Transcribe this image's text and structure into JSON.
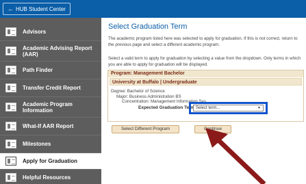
{
  "topbar": {
    "back_label": "HUB Student Center",
    "color": "#0b5ea8"
  },
  "sidebar": {
    "items": [
      {
        "label": "Advisors",
        "active": false
      },
      {
        "label": "Academic Advising Report (AAR)",
        "active": false
      },
      {
        "label": "Path Finder",
        "active": false
      },
      {
        "label": "Transfer Credit Report",
        "active": false
      },
      {
        "label": "Academic Program Information",
        "active": false
      },
      {
        "label": "What-If AAR Report",
        "active": false
      },
      {
        "label": "Milestones",
        "active": false
      },
      {
        "label": "Apply for Graduation",
        "active": true
      },
      {
        "label": "Helpful Resources",
        "active": false
      }
    ]
  },
  "main": {
    "title": "Select Graduation Term",
    "intro": "The academic program listed here was selected to apply for graduation. If this is not correct, return to the previous page and select a different academic program.",
    "instructions": "Select a valid term to apply for graduation by selecting a value from the dropdown. Only terms in which you are able to apply for graduation will be displayed.",
    "program_header": "Program: Management Bachelor",
    "university_header": "University at Buffalo | Undergraduate",
    "degree": "Degree: Bachelor of Science",
    "major": "Major: Business Administration BS",
    "concentration": "Concentration: Management Information Sys",
    "term_label": "Expected Graduation Term",
    "term_select": "Select term...",
    "buttons": {
      "select_program": "Select Different Program",
      "continue": "Continue"
    }
  },
  "colors": {
    "highlight_box": "#1155cc",
    "arrow": "#8b1a1a",
    "sidebar_bg": "#5d5d5d"
  }
}
